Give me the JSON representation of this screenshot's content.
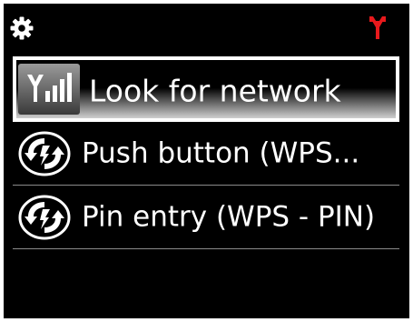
{
  "statusbar": {
    "settings_icon": "gear-icon",
    "network_icon": "antenna-icon",
    "network_icon_color": "#e8191c"
  },
  "menu": {
    "items": [
      {
        "label": "Look for network",
        "icon": "signal-bars-icon",
        "selected": true
      },
      {
        "label": "Push button (WPS...",
        "icon": "wps-icon",
        "selected": false
      },
      {
        "label": "Pin entry (WPS - PIN)",
        "icon": "wps-icon",
        "selected": false
      }
    ]
  },
  "colors": {
    "background": "#000000",
    "text": "#ffffff",
    "divider": "#8a8a8a",
    "selection_border": "#ffffff"
  }
}
